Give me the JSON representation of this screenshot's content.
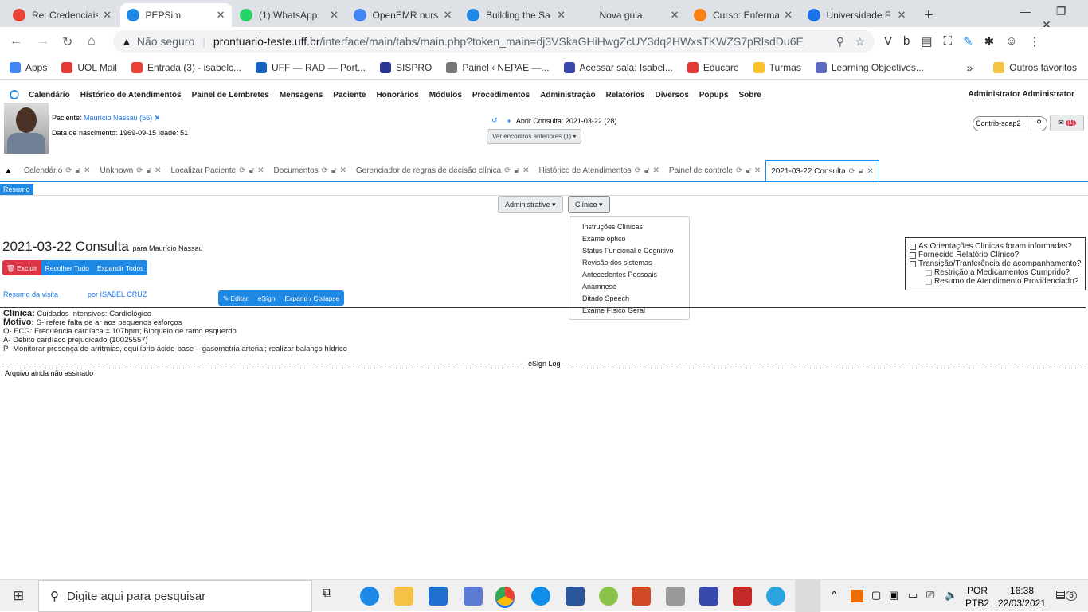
{
  "browser": {
    "tabs": [
      {
        "label": "Re: Credenciais",
        "icon": "gmail-icon",
        "color": "#ea4335"
      },
      {
        "label": "PEPSim",
        "icon": "openemr-icon",
        "color": "#1e88e5",
        "active": true
      },
      {
        "label": "(1) WhatsApp",
        "icon": "whatsapp-icon",
        "color": "#25d366"
      },
      {
        "label": "OpenEMR nursi",
        "icon": "google-icon",
        "color": "#4285f4"
      },
      {
        "label": "Building the Sa",
        "icon": "openemr-icon",
        "color": "#1e88e5"
      },
      {
        "label": "Nova guia",
        "icon": "",
        "color": "#dee1e6"
      },
      {
        "label": "Curso: Enferma",
        "icon": "moodle-icon",
        "color": "#f98012"
      },
      {
        "label": "Universidade F",
        "icon": "calendar-icon",
        "color": "#1a73e8"
      }
    ],
    "new_tab": "+",
    "not_secure": "Não seguro",
    "url_host": "prontuario-teste.uff.br",
    "url_path": "/interface/main/tabs/main.php?token_main=dj3VSkaGHiHwgZcUY3dq2HWxsTKWZS7pRlsdDu6E",
    "bookmarks": [
      {
        "label": "Apps",
        "color": "#4285f4"
      },
      {
        "label": "UOL Mail",
        "color": "#e53935"
      },
      {
        "label": "Entrada (3) - isabelc...",
        "color": "#ea4335"
      },
      {
        "label": "UFF — RAD — Port...",
        "color": "#1565c0"
      },
      {
        "label": "SISPRO",
        "color": "#283593"
      },
      {
        "label": "Painel ‹ NEPAE —...",
        "color": "#777"
      },
      {
        "label": "Acessar sala: Isabel...",
        "color": "#3949ab"
      },
      {
        "label": "Educare",
        "color": "#e53935"
      },
      {
        "label": "Turmas",
        "color": "#fbc02d"
      },
      {
        "label": "Learning Objectives...",
        "color": "#5c6bc0"
      }
    ],
    "more": "»",
    "other_favorites": "Outros favoritos"
  },
  "app": {
    "menu": [
      "Calendário",
      "Histórico de Atendimentos",
      "Painel de Lembretes",
      "Mensagens",
      "Paciente",
      "Honorários",
      "Módulos",
      "Procedimentos",
      "Administração",
      "Relatórios",
      "Diversos",
      "Popups",
      "Sobre"
    ],
    "user": "Administrator Administrator",
    "patient_label": "Paciente:",
    "patient_name": "Maurício Nassau (56)",
    "dob_line": "Data de nascimento: 1969-09-15 Idade: 51",
    "open_encounter": "Abrir Consulta: 2021-03-22 (28)",
    "past_encounters": "Ver encontros anteriores  (1)",
    "search_value": "Contrib-soap2",
    "messages_badge": "(1)",
    "tabs": [
      {
        "label": "Calendário"
      },
      {
        "label": "Unknown"
      },
      {
        "label": "Localizar Paciente"
      },
      {
        "label": "Documentos"
      },
      {
        "label": "Gerenciador de regras de decisão clínica"
      },
      {
        "label": "Histórico de Atendimentos"
      },
      {
        "label": "Painel de controle"
      },
      {
        "label": "2021-03-22 Consulta",
        "active": true
      }
    ],
    "resumo": "Resumo",
    "menu_admin": "Administrative",
    "menu_clinico": "Clínico",
    "clinico_items": [
      "Instruções Clínicas",
      "Exame óptico",
      "Status Funcional e Cognitivo",
      "Revisão dos sistemas",
      "Antecedentes Pessoais",
      "Anamnese",
      "Ditado Speech",
      "Exame Físico Geral"
    ],
    "enc_title": "2021-03-22 Consulta",
    "enc_for": "para Maurício Nassau",
    "btn_delete": "Excluir",
    "btn_collapse": "Recolher Tudo",
    "btn_expand": "Expandir Todos",
    "visit_summary": "Resumo da visita",
    "by": "por ISABEL CRUZ",
    "btn_edit": "Editar",
    "btn_esign": "eSign",
    "btn_expcol": "Expand / Collapse",
    "checks": [
      {
        "label": "As Orientações Clínicas foram informadas?",
        "sub": false
      },
      {
        "label": "Fornecido Relatório Clínico?",
        "sub": false
      },
      {
        "label": "Transição/Tranferência de acompanhamento?",
        "sub": false
      },
      {
        "label": "Restrição a Medicamentos Cumprido?",
        "sub": true
      },
      {
        "label": "Resumo de Atendimento Providenciado?",
        "sub": true
      }
    ],
    "clinica_label": "Clínica:",
    "clinica_value": "Cuidados Intensivos: Cardiológico",
    "motivo_label": "Motivo:",
    "motivo_value": "S- refere falta de ar aos pequenos esforços",
    "lines": [
      "O- ECG: Frequência cardíaca = 107bpm; Bloqueio de ramo esquerdo",
      "A- Débito cardíaco prejudicado (10025557)",
      "P- Monitorar presença de arritmias, equilíbrio ácido-base – gasometria arterial; realizar balanço hídrico"
    ],
    "esign_log": "eSign Log",
    "unsigned": "Arquivo ainda não assinado"
  },
  "taskbar": {
    "search_placeholder": "Digite aqui para pesquisar",
    "lang1": "POR",
    "lang2": "PTB2",
    "time": "16:38",
    "date": "22/03/2021",
    "notifications": "6"
  }
}
